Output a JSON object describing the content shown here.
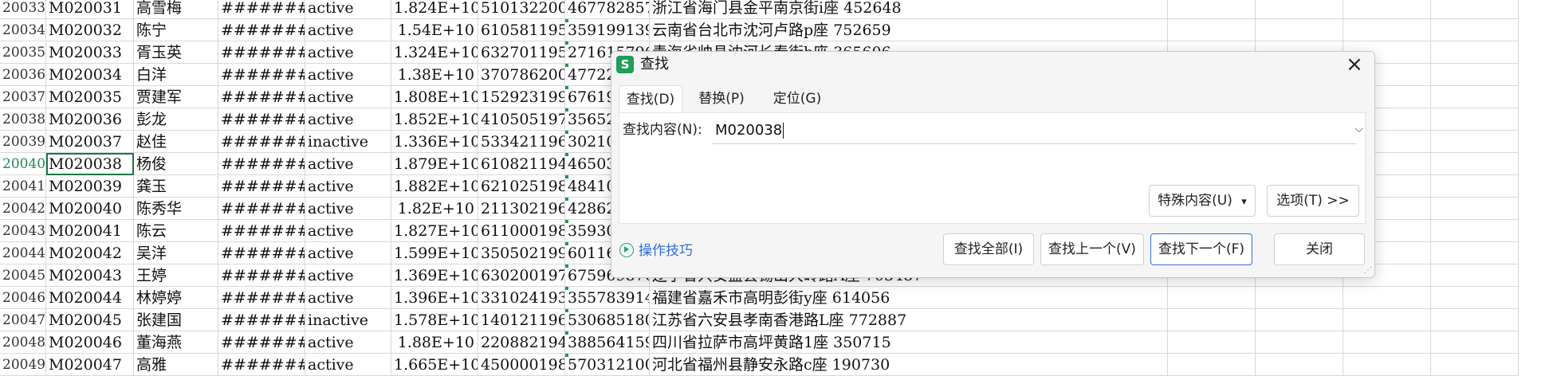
{
  "sheet": {
    "rows": [
      {
        "num": "20033",
        "id": "M020031",
        "name": "高雪梅",
        "date": "#########",
        "status": "active",
        "big": "1.824E+10",
        "id1": "510132200",
        "id2": "467782857",
        "addr": "浙江省海门县金平南京街i座 452648"
      },
      {
        "num": "20034",
        "id": "M020032",
        "name": "陈宁",
        "date": "#########",
        "status": "active",
        "big": "1.54E+10",
        "id1": "610581195",
        "id2": "359199139",
        "addr": "云南省台北市沈河卢路p座 752659"
      },
      {
        "num": "20035",
        "id": "M020033",
        "name": "胥玉英",
        "date": "#########",
        "status": "active",
        "big": "1.324E+10",
        "id1": "632701195",
        "id2": "271615796",
        "addr": "青海省帅县沈河长春街b座 365606"
      },
      {
        "num": "20036",
        "id": "M020034",
        "name": "白洋",
        "date": "#########",
        "status": "active",
        "big": "1.38E+10",
        "id1": "370786200",
        "id2": "47722",
        "addr": ""
      },
      {
        "num": "20037",
        "id": "M020035",
        "name": "贾建军",
        "date": "#########",
        "status": "active",
        "big": "1.808E+10",
        "id1": "152923199",
        "id2": "67619",
        "addr": ""
      },
      {
        "num": "20038",
        "id": "M020036",
        "name": "彭龙",
        "date": "#########",
        "status": "active",
        "big": "1.852E+10",
        "id1": "410505197",
        "id2": "35652",
        "addr": ""
      },
      {
        "num": "20039",
        "id": "M020037",
        "name": "赵佳",
        "date": "#########",
        "status": "inactive",
        "big": "1.336E+10",
        "id1": "533421196",
        "id2": "30210",
        "addr": ""
      },
      {
        "num": "20040",
        "id": "M020038",
        "name": "杨俊",
        "date": "#########",
        "status": "active",
        "big": "1.879E+10",
        "id1": "610821194",
        "id2": "46503",
        "addr": ""
      },
      {
        "num": "20041",
        "id": "M020039",
        "name": "龚玉",
        "date": "#########",
        "status": "active",
        "big": "1.882E+10",
        "id1": "621025198",
        "id2": "48410",
        "addr": ""
      },
      {
        "num": "20042",
        "id": "M020040",
        "name": "陈秀华",
        "date": "#########",
        "status": "active",
        "big": "1.82E+10",
        "id1": "211302196",
        "id2": "42862",
        "addr": ""
      },
      {
        "num": "20043",
        "id": "M020041",
        "name": "陈云",
        "date": "#########",
        "status": "active",
        "big": "1.827E+10",
        "id1": "611000198",
        "id2": "35930",
        "addr": ""
      },
      {
        "num": "20044",
        "id": "M020042",
        "name": "吴洋",
        "date": "#########",
        "status": "active",
        "big": "1.599E+10",
        "id1": "350502199",
        "id2": "60116",
        "addr": ""
      },
      {
        "num": "20045",
        "id": "M020043",
        "name": "王婷",
        "date": "#########",
        "status": "active",
        "big": "1.369E+10",
        "id1": "630200197",
        "id2": "675969870",
        "addr": "辽宁省兴安盟县锡山大岭路A座 703487"
      },
      {
        "num": "20046",
        "id": "M020044",
        "name": "林婷婷",
        "date": "#########",
        "status": "active",
        "big": "1.396E+10",
        "id1": "331024193",
        "id2": "355783914",
        "addr": "福建省嘉禾市高明彭街y座 614056"
      },
      {
        "num": "20047",
        "id": "M020045",
        "name": "张建国",
        "date": "#########",
        "status": "inactive",
        "big": "1.578E+10",
        "id1": "140121196",
        "id2": "530685180",
        "addr": "江苏省六安县孝南香港路L座 772887"
      },
      {
        "num": "20048",
        "id": "M020046",
        "name": "董海燕",
        "date": "#########",
        "status": "active",
        "big": "1.88E+10",
        "id1": "220882194",
        "id2": "388564159",
        "addr": "四川省拉萨市高坪黄路1座 350715"
      },
      {
        "num": "20049",
        "id": "M020047",
        "name": "高雅",
        "date": "#########",
        "status": "active",
        "big": "1.665E+10",
        "id1": "450000198",
        "id2": "570312100",
        "addr": "河北省福州县静安永路c座 190730"
      }
    ],
    "selected_row": "20040"
  },
  "dialog": {
    "title": "查找",
    "logo": "S",
    "close_icon": "×",
    "tabs": [
      {
        "label": "查找(D)",
        "active": true
      },
      {
        "label": "替换(P)",
        "active": false
      },
      {
        "label": "定位(G)",
        "active": false
      }
    ],
    "find_label": "查找内容(N):",
    "find_value": "M020038",
    "dropdown_arrow": "⌵",
    "special_label": "特殊内容(U)",
    "special_arrow": "▾",
    "options_label": "选项(T) >>",
    "tips_label": "操作技巧",
    "find_all_label": "查找全部(I)",
    "find_prev_label": "查找上一个(V)",
    "find_next_label": "查找下一个(F)",
    "close_label": "关闭",
    "accent_color": "#2f6fd6",
    "logo_color": "#1e9e58"
  }
}
